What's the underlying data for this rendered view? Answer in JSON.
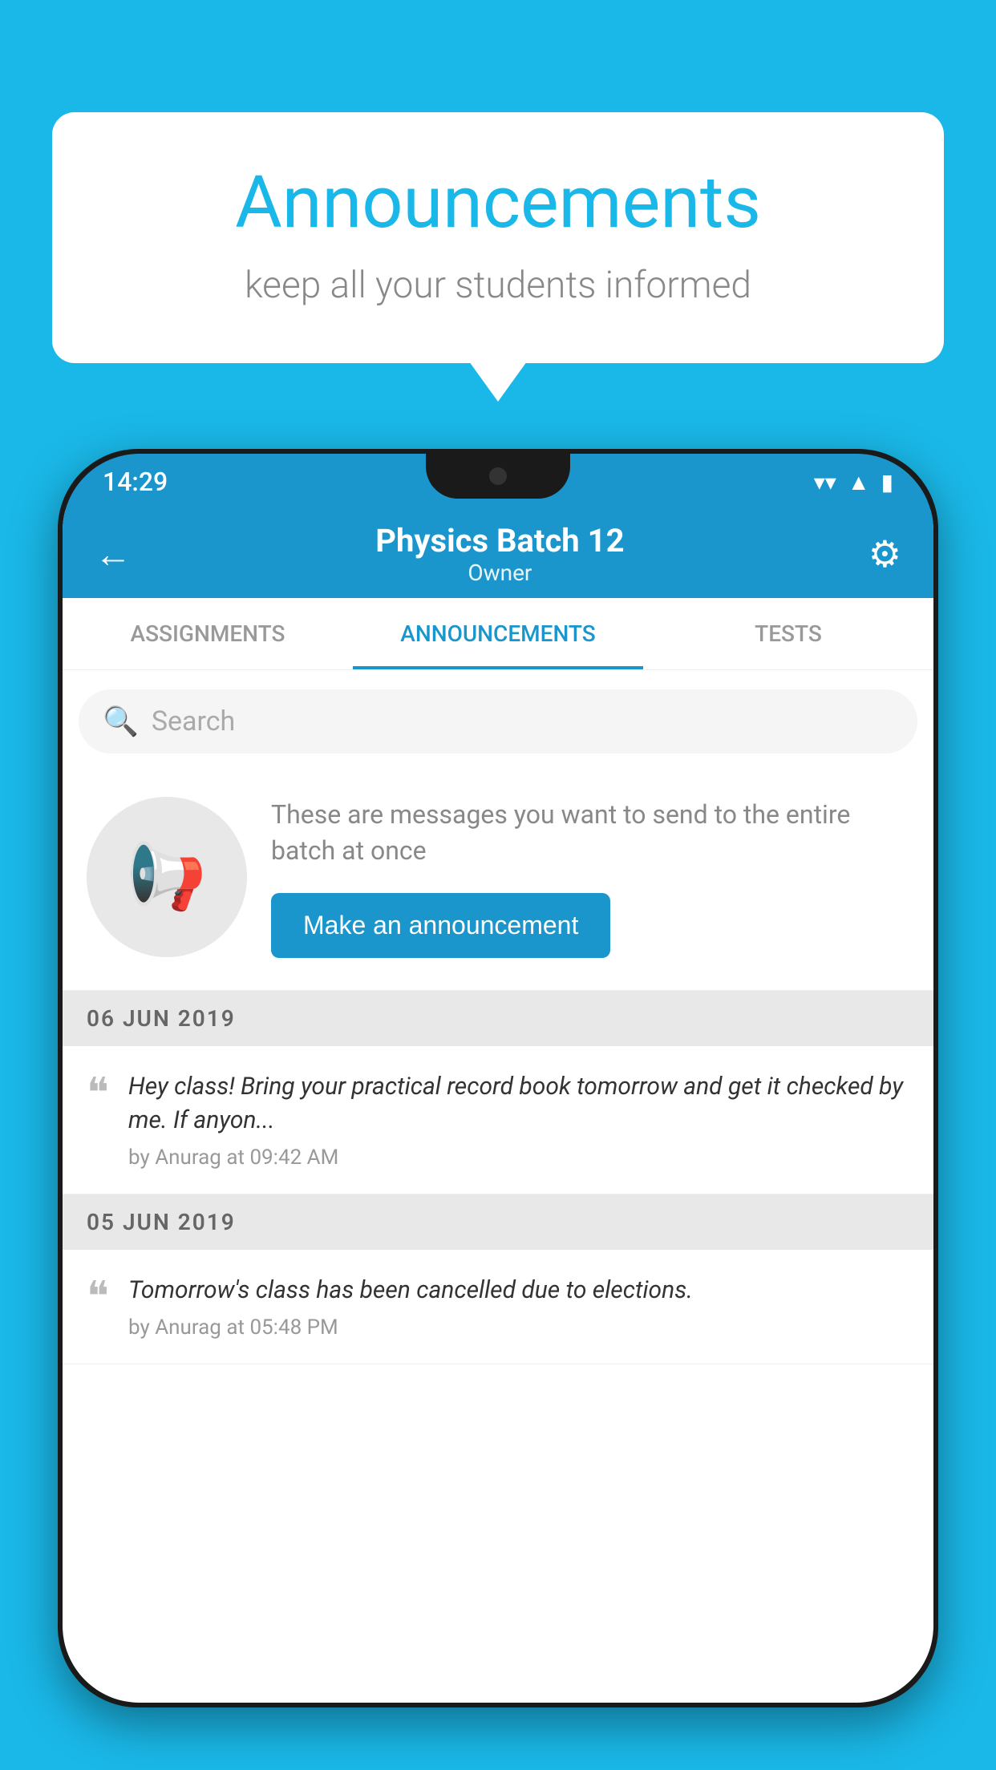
{
  "background": {
    "color": "#1ab8e8"
  },
  "speech_bubble": {
    "title": "Announcements",
    "subtitle": "keep all your students informed"
  },
  "phone": {
    "status_bar": {
      "time": "14:29",
      "wifi": "▼",
      "signal": "▲",
      "battery": "▮"
    },
    "header": {
      "title": "Physics Batch 12",
      "subtitle": "Owner",
      "back_label": "←",
      "gear_label": "⚙"
    },
    "tabs": [
      {
        "label": "ASSIGNMENTS",
        "active": false
      },
      {
        "label": "ANNOUNCEMENTS",
        "active": true
      },
      {
        "label": "TESTS",
        "active": false
      }
    ],
    "search": {
      "placeholder": "Search"
    },
    "announcement_prompt": {
      "description": "These are messages you want to send to the entire batch at once",
      "button_label": "Make an announcement"
    },
    "announcements": [
      {
        "date": "06  JUN  2019",
        "text": "Hey class! Bring your practical record book tomorrow and get it checked by me. If anyon...",
        "meta": "by Anurag at 09:42 AM"
      },
      {
        "date": "05  JUN  2019",
        "text": "Tomorrow's class has been cancelled due to elections.",
        "meta": "by Anurag at 05:48 PM"
      }
    ]
  }
}
